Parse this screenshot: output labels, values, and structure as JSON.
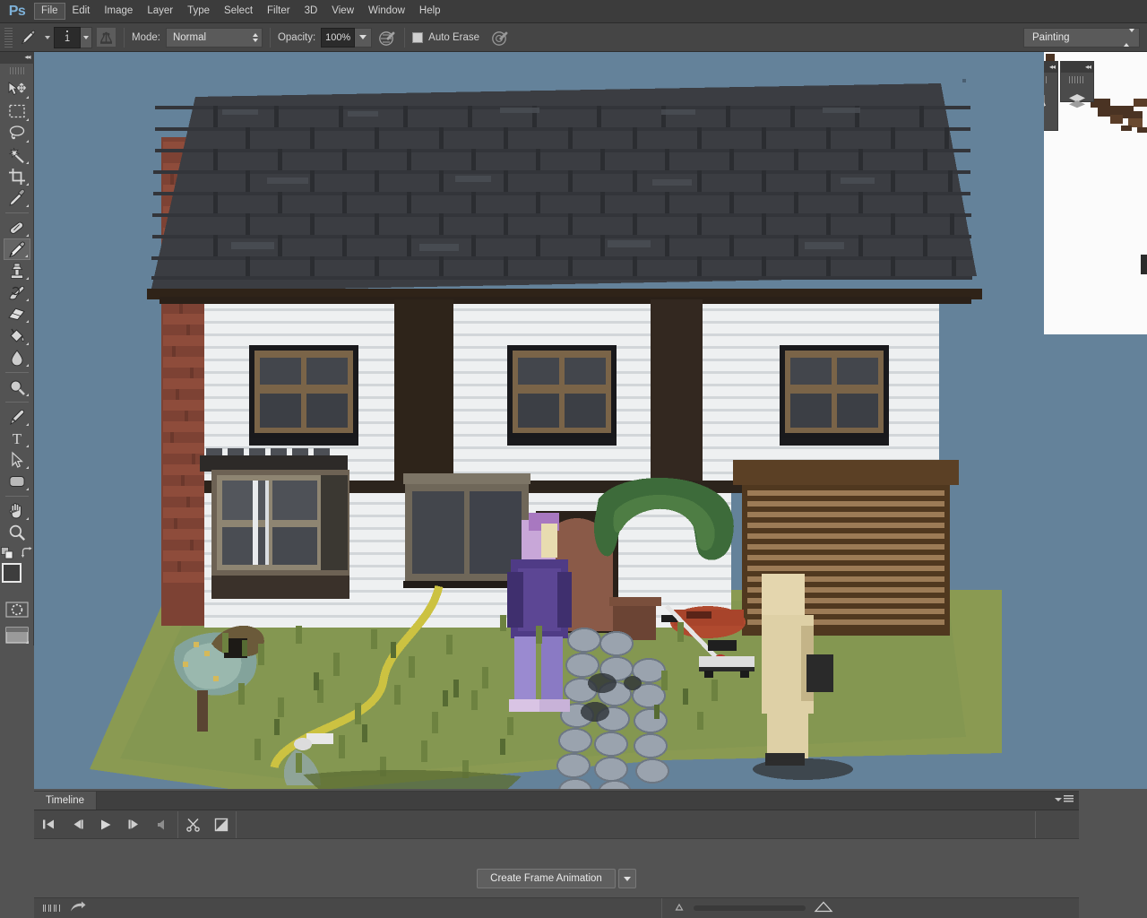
{
  "app": {
    "name": "Ps",
    "logo_color": "#7eb2d9"
  },
  "menubar": {
    "items": [
      {
        "label": "File",
        "mnemonic": "F",
        "active": true
      },
      {
        "label": "Edit",
        "mnemonic": "E",
        "active": false
      },
      {
        "label": "Image",
        "mnemonic": "I",
        "active": false
      },
      {
        "label": "Layer",
        "mnemonic": "L",
        "active": false
      },
      {
        "label": "Type",
        "mnemonic": "Y",
        "active": false
      },
      {
        "label": "Select",
        "mnemonic": "S",
        "active": false
      },
      {
        "label": "Filter",
        "mnemonic": "t",
        "active": false
      },
      {
        "label": "3D",
        "mnemonic": "D",
        "active": false
      },
      {
        "label": "View",
        "mnemonic": "V",
        "active": false
      },
      {
        "label": "Window",
        "mnemonic": "W",
        "active": false
      },
      {
        "label": "Help",
        "mnemonic": "H",
        "active": false
      }
    ]
  },
  "options_bar": {
    "tool_icon": "pencil-icon",
    "brush_size_value": "1",
    "brush_panel_icon": "brush-panel-icon",
    "mode_label": "Mode:",
    "mode_value": "Normal",
    "opacity_label": "Opacity:",
    "opacity_value": "100%",
    "opacity_pressure_icon": "pressure-opacity-icon",
    "auto_erase_label": "Auto Erase",
    "auto_erase_checked": false,
    "tablet_pressure_icon": "pressure-size-icon",
    "workspace_value": "Painting"
  },
  "toolbar": {
    "collapse_icon": "double-chevron-left-icon",
    "tools": [
      {
        "name": "move-tool",
        "icon": "move-icon",
        "selected": false,
        "has_flyout": true
      },
      {
        "name": "rectangular-marquee-tool",
        "icon": "marquee-icon",
        "selected": false,
        "has_flyout": true
      },
      {
        "name": "lasso-tool",
        "icon": "lasso-icon",
        "selected": false,
        "has_flyout": true
      },
      {
        "name": "magic-wand-tool",
        "icon": "magic-wand-icon",
        "selected": false,
        "has_flyout": true
      },
      {
        "name": "crop-tool",
        "icon": "crop-icon",
        "selected": false,
        "has_flyout": true
      },
      {
        "name": "eyedropper-tool",
        "icon": "eyedropper-icon",
        "selected": false,
        "has_flyout": true
      },
      {
        "name": "healing-brush-tool",
        "icon": "bandage-icon",
        "selected": false,
        "has_flyout": true
      },
      {
        "name": "pencil-tool",
        "icon": "pencil-icon",
        "selected": true,
        "has_flyout": true
      },
      {
        "name": "clone-stamp-tool",
        "icon": "stamp-icon",
        "selected": false,
        "has_flyout": true
      },
      {
        "name": "history-brush-tool",
        "icon": "history-brush-icon",
        "selected": false,
        "has_flyout": true
      },
      {
        "name": "eraser-tool",
        "icon": "eraser-icon",
        "selected": false,
        "has_flyout": true
      },
      {
        "name": "gradient-tool",
        "icon": "paint-bucket-icon",
        "selected": false,
        "has_flyout": true
      },
      {
        "name": "blur-tool",
        "icon": "blur-drop-icon",
        "selected": false,
        "has_flyout": true
      },
      {
        "name": "dodge-tool",
        "icon": "dodge-icon",
        "selected": false,
        "has_flyout": true
      },
      {
        "name": "pen-tool",
        "icon": "pen-nib-icon",
        "selected": false,
        "has_flyout": true
      },
      {
        "name": "type-tool",
        "icon": "text-T-icon",
        "selected": false,
        "has_flyout": true
      },
      {
        "name": "path-selection-tool",
        "icon": "arrow-cursor-icon",
        "selected": false,
        "has_flyout": true
      },
      {
        "name": "shape-tool",
        "icon": "rounded-rect-icon",
        "selected": false,
        "has_flyout": true
      },
      {
        "name": "hand-tool",
        "icon": "hand-icon",
        "selected": false,
        "has_flyout": true
      },
      {
        "name": "zoom-tool",
        "icon": "magnifier-icon",
        "selected": false,
        "has_flyout": false
      }
    ],
    "default_colors_icon": "default-colors-icon",
    "swap_colors_icon": "swap-colors-icon",
    "foreground_color": "#3d3d3d",
    "background_color": "#fdfdfd",
    "quick_mask_icon": "quick-mask-icon",
    "screen_mode_icon": "screen-mode-icon"
  },
  "canvas": {
    "background_color": "#64829a",
    "artwork_description": "pixel-art-suburban-house-scene"
  },
  "right_dock": {
    "character_panel_icon": "character-A-icon",
    "paragraph_panel_icon": "paragraph-pilcrow-icon",
    "layers_panel_icon": "layers-stack-icon",
    "collapse_icon": "double-chevron-right-icon"
  },
  "timeline": {
    "tab_label": "Timeline",
    "panel_menu_icon": "panel-menu-icon",
    "controls": [
      {
        "name": "go-to-first-frame-button",
        "icon": "skip-start-icon"
      },
      {
        "name": "previous-frame-button",
        "icon": "step-back-icon"
      },
      {
        "name": "play-button",
        "icon": "play-icon"
      },
      {
        "name": "next-frame-button",
        "icon": "step-forward-icon"
      },
      {
        "name": "audio-mute-button",
        "icon": "speaker-icon"
      }
    ],
    "edit_controls": [
      {
        "name": "split-clip-button",
        "icon": "scissors-icon"
      },
      {
        "name": "transition-button",
        "icon": "transition-icon"
      }
    ],
    "create_frame_animation_label": "Create Frame Animation",
    "create_frame_animation_dropdown_icon": "chevron-down-icon",
    "footer": {
      "convert-to-frame-animation-icon": "frames-icon",
      "render-video-icon": "render-arrow-icon",
      "zoom_out_icon": "zoom-out-small-icon",
      "zoom_in_icon": "zoom-in-large-icon"
    }
  },
  "chart_data": null
}
